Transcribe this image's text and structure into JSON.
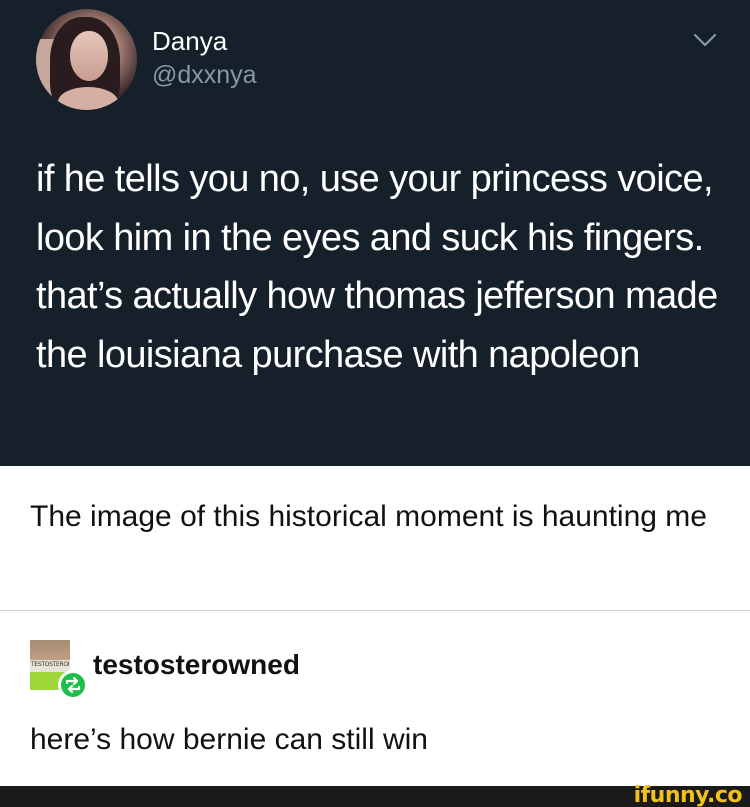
{
  "tweet": {
    "display_name": "Danya",
    "handle": "@dxxnya",
    "text": "if he tells you no, use your princess voice, look him in the eyes and suck his fingers. that’s actually how thomas jefferson made the louisiana purchase with napoleon",
    "menu_icon": "chevron-down-icon",
    "background": "#15202b"
  },
  "caption": {
    "text": "The image of this historical moment is haunting me"
  },
  "reblog": {
    "username": "testosterowned",
    "avatar_label": "TESTOSTERONE",
    "badge_icon": "reblog-icon",
    "badge_color": "#1bbf4a",
    "text": "here’s how bernie can still win"
  },
  "footer": {
    "watermark": "ifunny.co",
    "watermark_color": "#f3c21a"
  }
}
